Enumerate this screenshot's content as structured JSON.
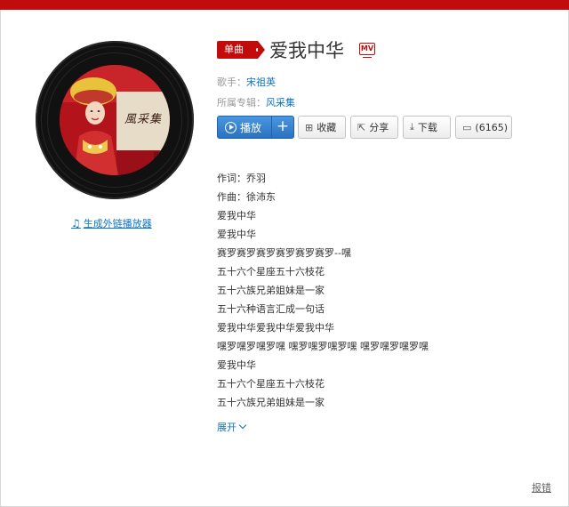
{
  "song": {
    "badge": "单曲",
    "title": "爱我中华",
    "mv_icon_label": "MV"
  },
  "meta": {
    "singer_label": "歌手：",
    "singer": "宋祖英",
    "album_label": "所属专辑：",
    "album": "风采集"
  },
  "cover": {
    "title_text": "風采集"
  },
  "actions": {
    "play": "播放",
    "add": "+",
    "collect": "收藏",
    "share": "分享",
    "download": "下载",
    "comment": "(6165)"
  },
  "icons": {
    "play": "play-circle-icon",
    "collect": "folder-plus-icon",
    "share": "share-icon",
    "download": "download-icon",
    "comment": "comment-icon",
    "ext_player": "music-note-icon"
  },
  "ext_player_link": "生成外链播放器",
  "lyrics": [
    "作词：乔羽",
    "作曲：徐沛东",
    "爱我中华",
    "爱我中华",
    "赛罗赛罗赛罗赛罗赛罗赛罗--嘿",
    "五十六个星座五十六枝花",
    "五十六族兄弟姐妹是一家",
    "五十六种语言汇成一句话",
    "爱我中华爱我中华爱我中华",
    "嘿罗嘿罗嘿罗嘿 嘿罗嘿罗嘿罗嘿 嘿罗嘿罗嘿罗嘿",
    "爱我中华",
    "五十六个星座五十六枝花",
    "五十六族兄弟姐妹是一家"
  ],
  "expand": "展开",
  "report": "报错",
  "colors": {
    "brand_red": "#c20c0c",
    "link_blue": "#0c73c2",
    "play_blue": "#2a72c0"
  }
}
